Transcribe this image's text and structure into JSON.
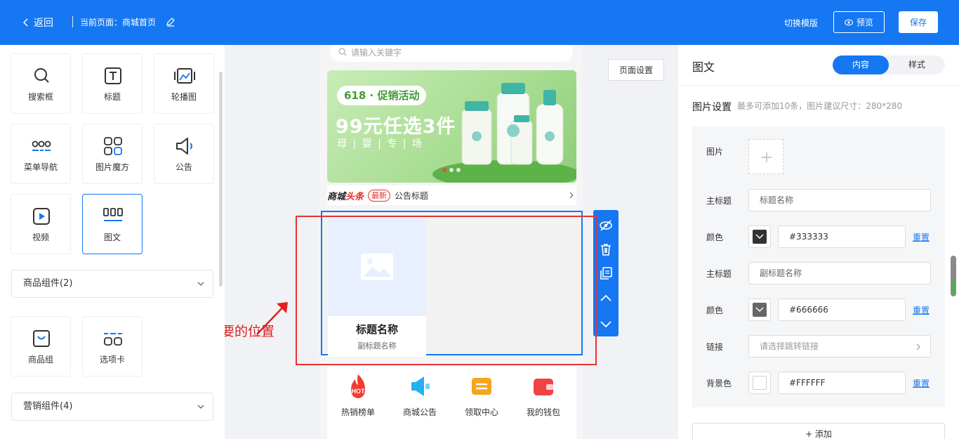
{
  "topbar": {
    "back_label": "返回",
    "current_page": "当前页面：商城首页",
    "switch_template": "切换模版",
    "preview_label": "预览",
    "save_label": "保存"
  },
  "components": {
    "basic": [
      {
        "label": "搜索框",
        "icon": "search-icon"
      },
      {
        "label": "标题",
        "icon": "title-icon"
      },
      {
        "label": "轮播图",
        "icon": "carousel-icon"
      },
      {
        "label": "菜单导航",
        "icon": "menu-nav-icon"
      },
      {
        "label": "图片魔方",
        "icon": "image-cube-icon"
      },
      {
        "label": "公告",
        "icon": "notice-icon"
      },
      {
        "label": "视频",
        "icon": "video-icon"
      },
      {
        "label": "图文",
        "icon": "image-text-icon"
      }
    ],
    "goods_group_label": "商品组件(2)",
    "goods": [
      {
        "label": "商品组",
        "icon": "goods-group-icon"
      },
      {
        "label": "选项卡",
        "icon": "tabs-icon"
      }
    ],
    "marketing_group_label": "营销组件(4)"
  },
  "canvas": {
    "search_placeholder": "请输入关键字",
    "page_settings": "页面设置",
    "banner": {
      "tag": "618 · 促销活动",
      "headline": "99元任选3件",
      "subline": "母 | 婴 | 专 | 场"
    },
    "news": {
      "brand_part1": "商城",
      "brand_part2": "头条",
      "badge": "最新",
      "title": "公告标题"
    },
    "image_text": {
      "title": "标题名称",
      "subtitle": "副标题名称"
    },
    "hint": "将图文拖入至需要的位置",
    "icon_nav": [
      {
        "label": "热销榜单",
        "icon": "hot-icon"
      },
      {
        "label": "商城公告",
        "icon": "megaphone-icon"
      },
      {
        "label": "领取中心",
        "icon": "coupon-icon"
      },
      {
        "label": "我的钱包",
        "icon": "wallet-icon"
      }
    ]
  },
  "panel": {
    "title": "图文",
    "tab_content": "内容",
    "tab_style": "样式",
    "section_title": "图片设置",
    "section_note": "最多可添加10条，图片建议尺寸：280*280",
    "image_label": "图片",
    "main_title_label": "主标题",
    "main_title_placeholder": "标题名称",
    "color_label": "颜色",
    "color1": "#333333",
    "sub_title_label": "主标题",
    "sub_title_placeholder": "副标题名称",
    "color2": "#666666",
    "link_label": "链接",
    "link_placeholder": "请选择跳转链接",
    "bg_label": "背景色",
    "bg_color": "#FFFFFF",
    "reset_label": "重置",
    "add_label": "+ 添加"
  },
  "colors": {
    "primary": "#1677f2",
    "hint_red": "#e02020",
    "swatch_dark": "#333333",
    "swatch_mid": "#666666",
    "swatch_white": "#FFFFFF"
  }
}
